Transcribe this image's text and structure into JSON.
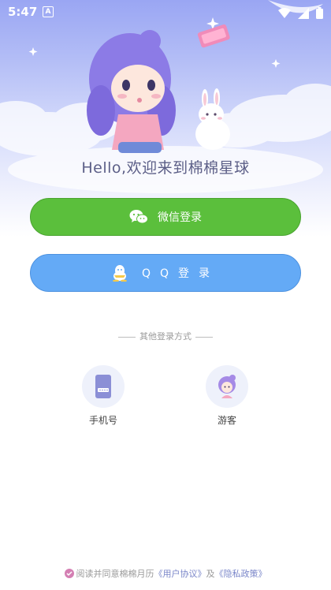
{
  "status_bar": {
    "time": "5:47",
    "notif_glyph": "A"
  },
  "hero": {
    "greeting": "Hello,欢迎来到棉棉星球"
  },
  "buttons": {
    "wechat_label": "微信登录",
    "qq_label": "QQ登录"
  },
  "divider": {
    "label": "其他登录方式"
  },
  "alt_login": [
    {
      "label": "手机号",
      "icon": "phone-icon"
    },
    {
      "label": "游客",
      "icon": "guest-avatar-icon"
    }
  ],
  "agreement": {
    "prefix": "阅读并同意棉棉月历",
    "user_agreement": "《用户协议》",
    "conj": "及",
    "privacy_policy": "《隐私政策》"
  },
  "colors": {
    "wechat": "#5bbf3c",
    "qq": "#64aaf6",
    "accent": "#d47fb3"
  }
}
